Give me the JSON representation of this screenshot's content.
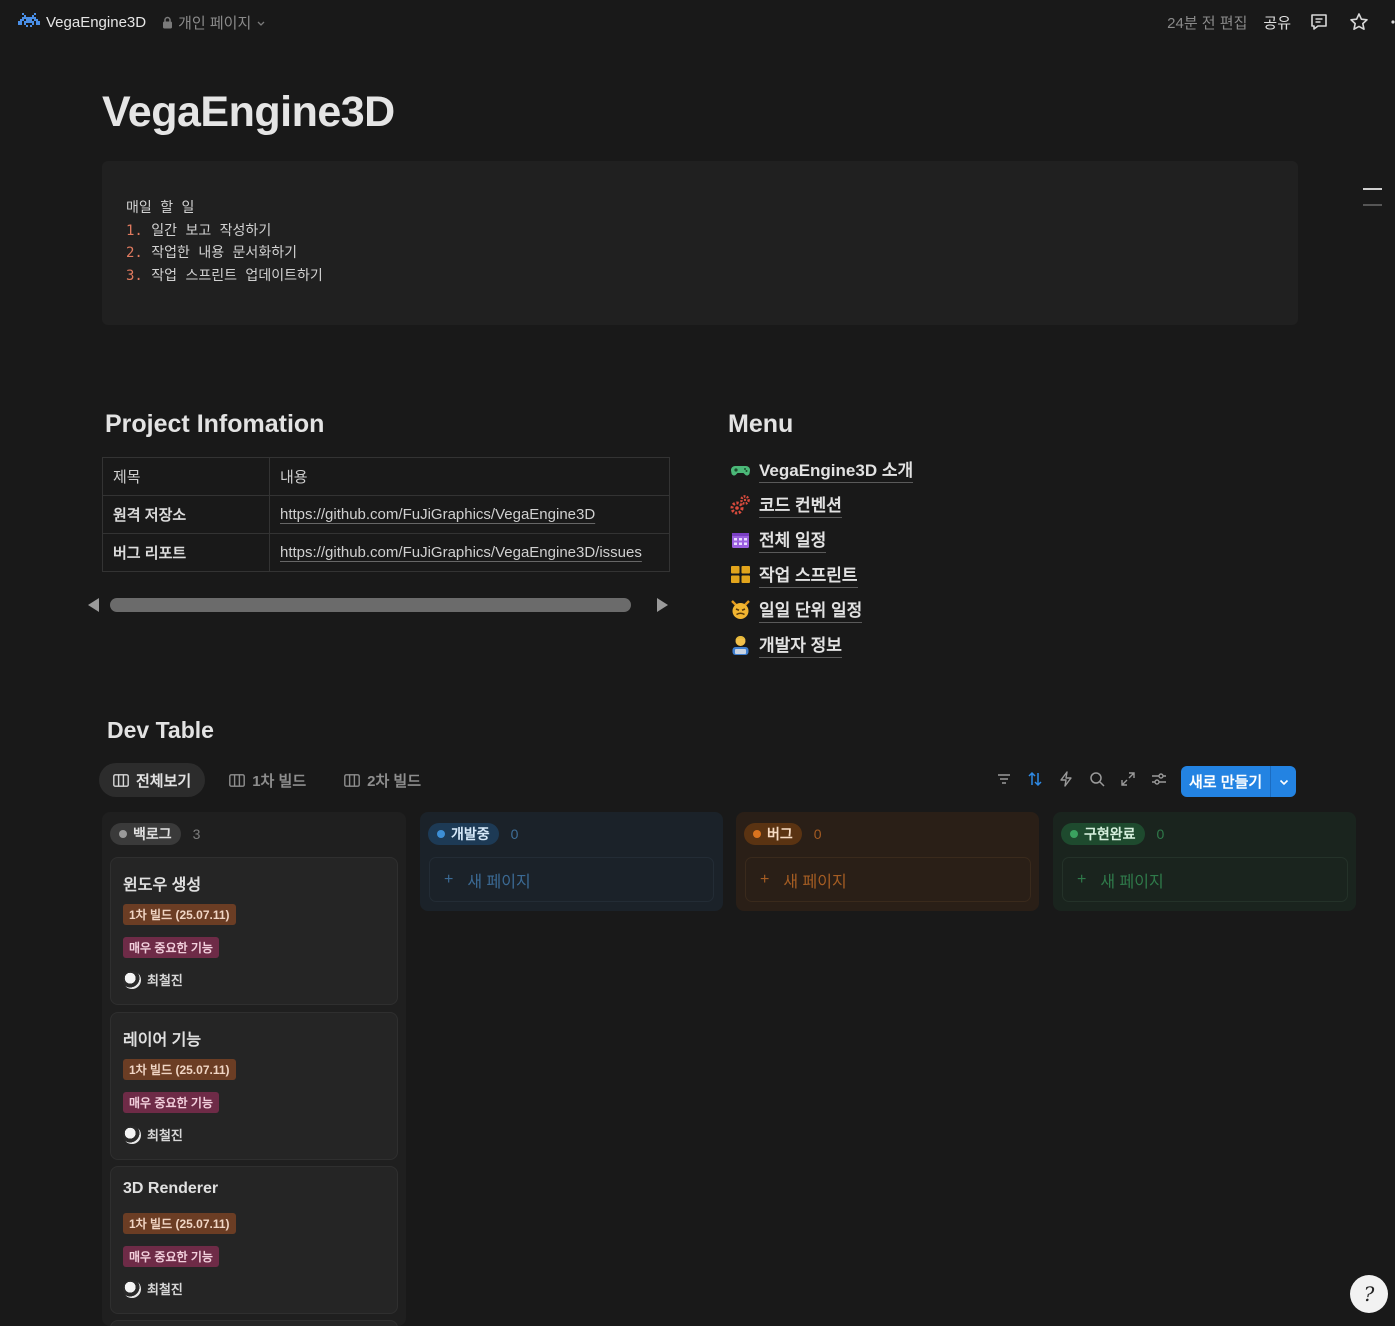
{
  "topbar": {
    "workspace_name": "VegaEngine3D",
    "privacy": "개인 페이지",
    "edited": "24분 전 편집",
    "share": "공유"
  },
  "page": {
    "title": "VegaEngine3D"
  },
  "code_block": {
    "heading": "매일 할 일",
    "items": [
      {
        "num": "1.",
        "text": "일간 보고 작성하기"
      },
      {
        "num": "2.",
        "text": "작업한 내용 문서화하기"
      },
      {
        "num": "3.",
        "text": "작업 스프린트 업데이트하기"
      }
    ]
  },
  "project_info": {
    "heading": "Project Infomation",
    "header": {
      "key": "제목",
      "value": "내용"
    },
    "rows": [
      {
        "key": "원격 저장소",
        "value": "https://github.com/FuJiGraphics/VegaEngine3D"
      },
      {
        "key": "버그 리포트",
        "value": "https://github.com/FuJiGraphics/VegaEngine3D/issues"
      }
    ]
  },
  "menu": {
    "heading": "Menu",
    "items": [
      {
        "label": "VegaEngine3D 소개",
        "icon": "game-controller-icon"
      },
      {
        "label": "코드 컨벤션",
        "icon": "gears-icon"
      },
      {
        "label": "전체 일정",
        "icon": "calendar-icon"
      },
      {
        "label": "작업 스프린트",
        "icon": "board-icon"
      },
      {
        "label": "일일 단위 일정",
        "icon": "devil-face-icon"
      },
      {
        "label": "개발자 정보",
        "icon": "developer-icon"
      }
    ]
  },
  "dev_table": {
    "heading": "Dev Table",
    "tabs": [
      {
        "label": "전체보기",
        "active": true
      },
      {
        "label": "1차 빌드",
        "active": false
      },
      {
        "label": "2차 빌드",
        "active": false
      }
    ],
    "new_button": "새로 만들기",
    "columns": [
      {
        "name": "백로그",
        "count": "3",
        "color": "#8e8e8e"
      },
      {
        "name": "개발중",
        "count": "0",
        "color": "#3d8fd6",
        "add_label": "새 페이지"
      },
      {
        "name": "버그",
        "count": "0",
        "color": "#d9731f",
        "add_label": "새 페이지"
      },
      {
        "name": "구현완료",
        "count": "0",
        "color": "#3aa25f",
        "add_label": "새 페이지"
      }
    ],
    "cards": [
      {
        "title": "윈도우 생성",
        "build": "1차 빌드 (25.07.11)",
        "priority": "매우 중요한 기능",
        "assignee": "최철진"
      },
      {
        "title": "레이어 기능",
        "build": "1차 빌드 (25.07.11)",
        "priority": "매우 중요한 기능",
        "assignee": "최철진"
      },
      {
        "title": "3D Renderer",
        "build": "1차 빌드 (25.07.11)",
        "priority": "매우 중요한 기능",
        "assignee": "최철진"
      }
    ]
  },
  "help": {
    "glyph": "?"
  }
}
